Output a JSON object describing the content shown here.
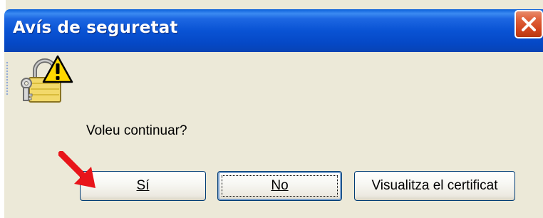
{
  "window": {
    "title": "Avís de seguretat",
    "close_icon": "close-icon"
  },
  "content": {
    "icon": "lock-warning-icon",
    "message": "Voleu continuar?"
  },
  "buttons": {
    "yes_label": "Sí",
    "no_label": "No",
    "view_certificate_label": "Visualitza el certificat"
  },
  "annotation": {
    "icon": "red-arrow-icon",
    "color": "#e8141a"
  },
  "colors": {
    "titlebar": "#0953d4",
    "close_button": "#d2451e",
    "dialog_background": "#ece9d8"
  }
}
